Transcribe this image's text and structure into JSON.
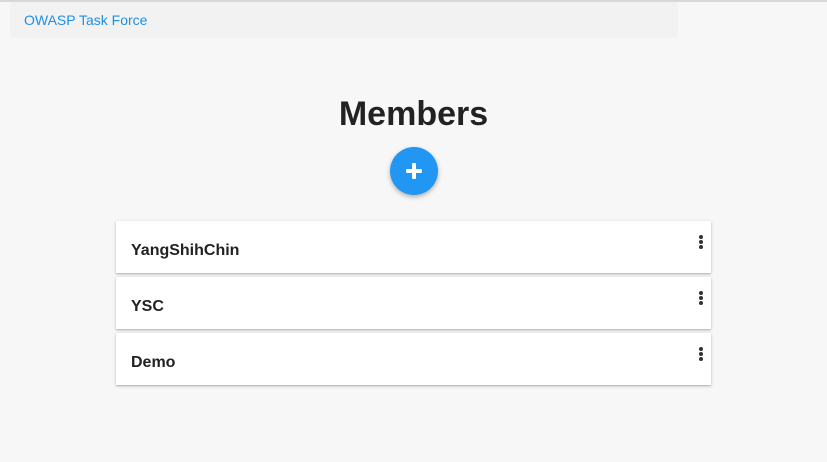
{
  "breadcrumb": {
    "link_text": "OWASP Task Force"
  },
  "page": {
    "title": "Members"
  },
  "add_button": {
    "icon": "plus-icon",
    "color": "#2196f3"
  },
  "members": [
    {
      "name": "YangShihChin",
      "menu_icon": "more-vertical-icon"
    },
    {
      "name": "YSC",
      "menu_icon": "more-vertical-icon"
    },
    {
      "name": "Demo",
      "menu_icon": "more-vertical-icon"
    }
  ]
}
